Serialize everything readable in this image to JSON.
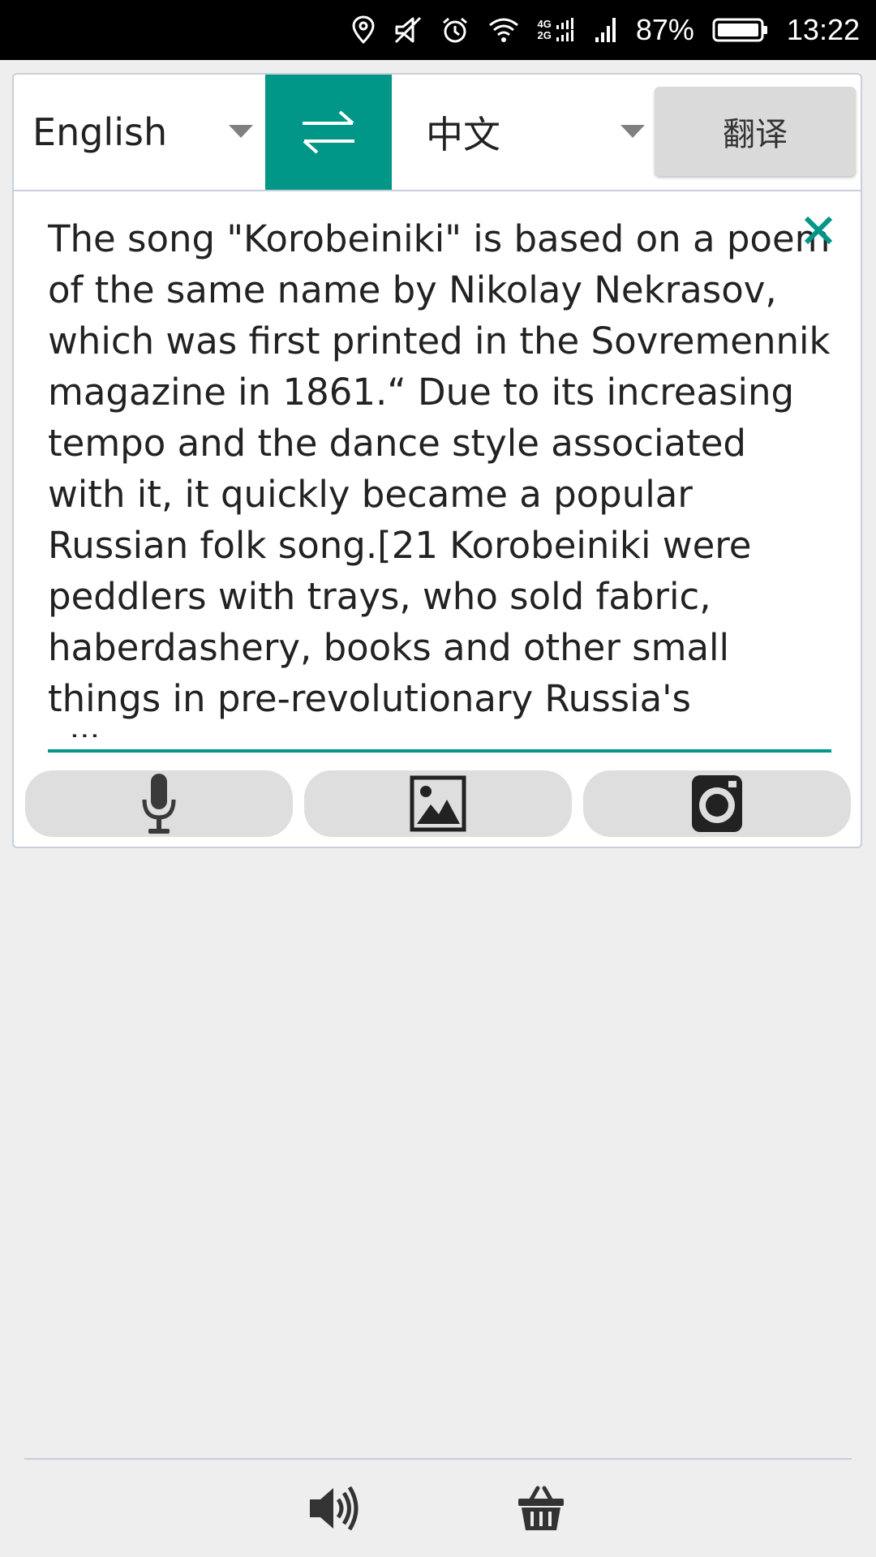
{
  "status_bar": {
    "network_top": "4G",
    "network_bottom": "2G",
    "battery": "87%",
    "time": "13:22",
    "icons": [
      "location-icon",
      "mute-icon",
      "alarm-icon",
      "wifi-icon",
      "dual-signal-icon",
      "signal-icon",
      "battery-icon"
    ]
  },
  "translator": {
    "source_language": "English",
    "target_language": "中文",
    "translate_label": "翻译",
    "input_text": "The song \"Korobeiniki\" is based on a poem of the same name by Nikolay Nekrasov, which was first printed in the Sovremennik magazine in 1861.“ Due to its increasing tempo and the dance style associated with it, it quickly became a popular Russian folk song.[21 Korobeiniki were peddlers with trays, who sold fabric, haberdashery, books and other small things in pre-revolutionary Russia's villages."
  },
  "tools": {
    "icons": [
      "microphone-icon",
      "image-icon",
      "camera-icon"
    ]
  },
  "bottom_bar": {
    "icons": [
      "speaker-icon",
      "basket-icon"
    ]
  },
  "colors": {
    "accent": "#009688",
    "background": "#eeeeee",
    "button_gray": "#dedede"
  }
}
